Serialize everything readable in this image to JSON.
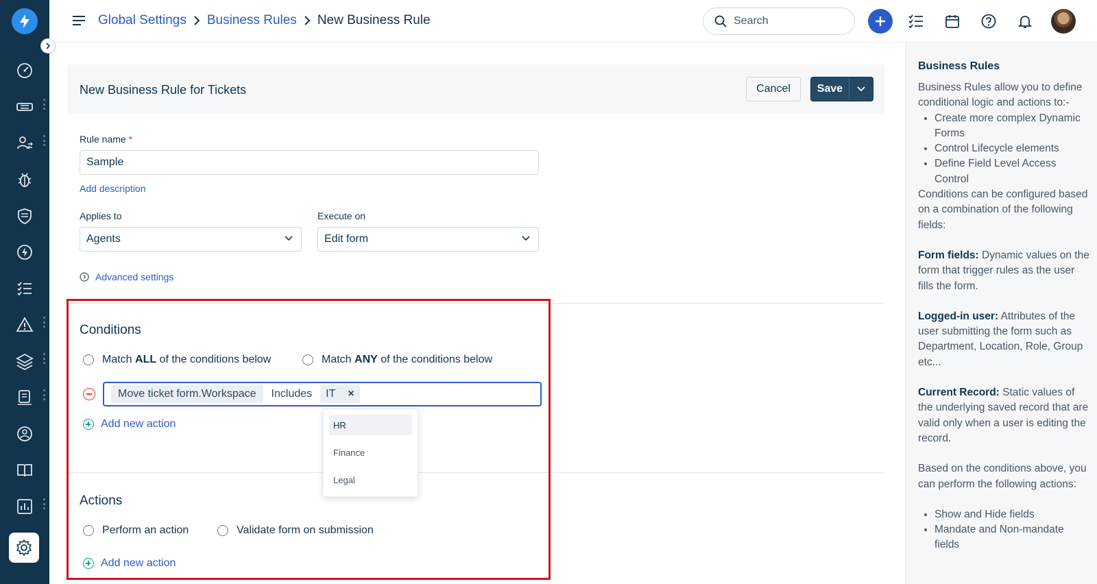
{
  "breadcrumb": {
    "items": [
      "Global Settings",
      "Business Rules"
    ],
    "current": "New Business Rule"
  },
  "search": {
    "placeholder": "Search"
  },
  "form_header": {
    "title": "New Business Rule for Tickets",
    "cancel_label": "Cancel",
    "save_label": "Save"
  },
  "rule_name": {
    "label": "Rule name",
    "required_mark": "*",
    "value": "Sample",
    "add_description": "Add description"
  },
  "applies_to": {
    "label": "Applies to",
    "value": "Agents"
  },
  "execute_on": {
    "label": "Execute on",
    "value": "Edit form"
  },
  "advanced_settings": "Advanced settings",
  "conditions": {
    "title": "Conditions",
    "match_all_pre": "Match ",
    "match_all_bold": "ALL",
    "match_all_post": " of the conditions below",
    "match_any_pre": "Match ",
    "match_any_bold": "ANY",
    "match_any_post": " of the conditions below",
    "row": {
      "field": "Move ticket form.Workspace",
      "operator": "Includes",
      "value_chip": "IT",
      "remove_glyph": "×"
    },
    "add_action": "Add new action",
    "dropdown_options": [
      "HR",
      "Finance",
      "Legal"
    ]
  },
  "actions": {
    "title": "Actions",
    "perform_action": "Perform an action",
    "validate_form": "Validate form on submission",
    "add_action": "Add new action"
  },
  "help_panel": {
    "title": "Business Rules",
    "intro": "Business Rules allow you to define conditional logic and actions to:-",
    "intro_bullets": [
      "Create more complex Dynamic Forms",
      "Control Lifecycle elements",
      "Define Field Level Access Control"
    ],
    "conditions_text": "Conditions can be configured based on a combination of the following fields:",
    "form_fields_label": "Form fields:",
    "form_fields_text": " Dynamic values on the form that trigger rules as the user fills the form.",
    "logged_in_label": "Logged-in user:",
    "logged_in_text": " Attributes of the user submitting the form such as Department, Location, Role, Group etc...",
    "current_record_label": "Current Record:",
    "current_record_text": " Static values of the underlying saved record that are valid only when a user is editing the record.",
    "based_on_text": "Based on the conditions above, you can perform the following actions:",
    "action_bullets": [
      "Show and Hide fields",
      "Mandate and Non-mandate fields"
    ]
  },
  "colors": {
    "rail": "#12344d",
    "accent": "#2c5cc5",
    "save": "#264966",
    "highlight_box": "#d4131c"
  }
}
